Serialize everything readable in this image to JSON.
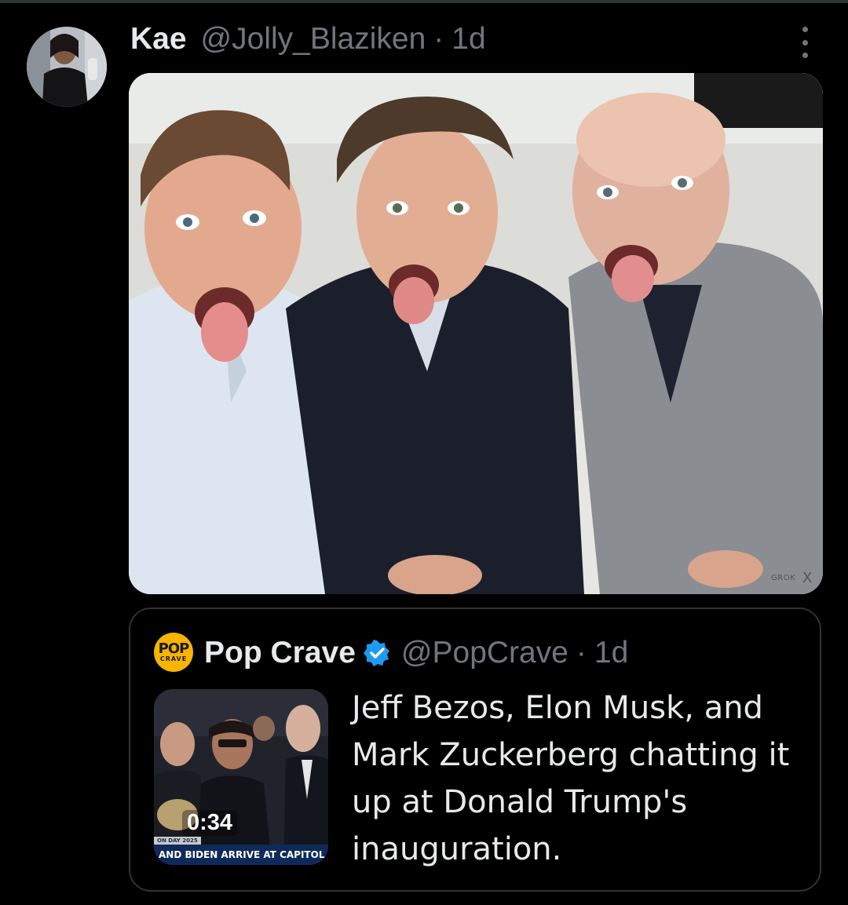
{
  "tweet": {
    "display_name": "Kae",
    "handle": "@Jolly_Blaziken",
    "separator": "·",
    "time": "1d",
    "media_watermark": "GROK",
    "media_watermark_mark": "X"
  },
  "quote": {
    "avatar_top": "POP",
    "avatar_bottom": "CRAVE",
    "display_name": "Pop Crave",
    "handle": "@PopCrave",
    "separator": "·",
    "time": "1d",
    "text": "Jeff Bezos, Elon Musk, and Mark Zuckerberg chatting it up at Donald Trump's inauguration.",
    "video": {
      "duration": "0:34",
      "ticker_tag": "ON DAY 2025",
      "ticker_text": "AND BIDEN ARRIVE AT CAPITOL FOR I"
    }
  },
  "colors": {
    "background": "#000000",
    "primary_text": "#e7e9ea",
    "secondary_text": "#71767b",
    "border": "#2f3336",
    "verified_blue": "#1d9bf0",
    "pop_crave_yellow": "#f7b500"
  },
  "icons": {
    "more": "more-vertical-icon",
    "verified": "verified-badge-icon"
  }
}
